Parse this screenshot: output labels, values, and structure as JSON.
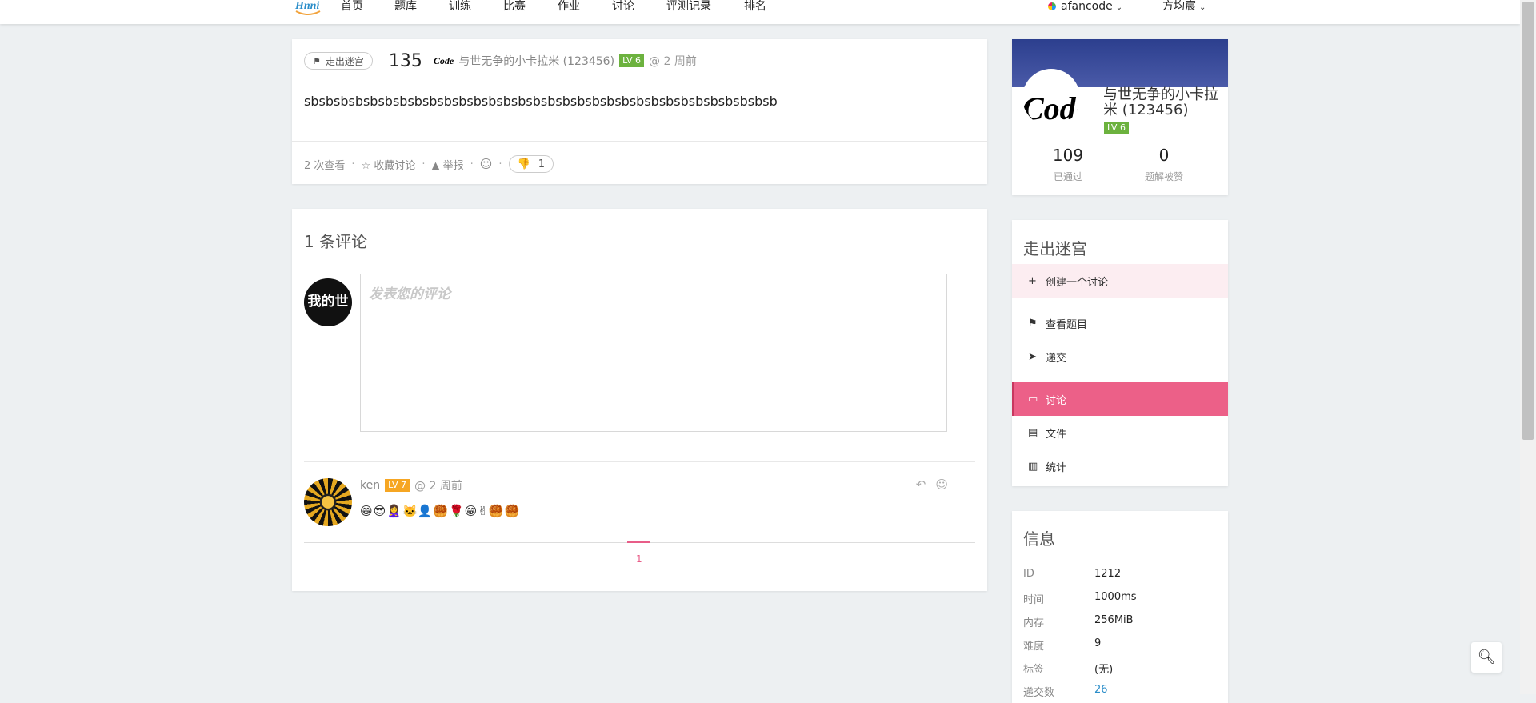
{
  "nav": {
    "logo": "Hnni",
    "items": [
      "首页",
      "题库",
      "训练",
      "比赛",
      "作业",
      "讨论",
      "评测记录",
      "排名"
    ],
    "user": "afancode",
    "account": "方均宸"
  },
  "discussion": {
    "tag": "走出迷宫",
    "title": "135",
    "author_avatar_text": "Code",
    "author": "与世无争的小卡拉米 (123456)",
    "level": "LV 6",
    "time": "@ 2 周前",
    "body": "sbsbsbsbsbsbsbsbsbsbsbsbsbsbsbsbsbsbsbsbsbsbsbsbsbsbsbsbsbsbsbsb",
    "views": "2 次查看",
    "star": "☆ 收藏讨论",
    "report": "▲ 举报",
    "emoji": "☺",
    "thumbs": "1"
  },
  "comments": {
    "title": "1 条评论",
    "my_avatar_text": "我的世界",
    "placeholder": "发表您的评论",
    "list": [
      {
        "user": "ken",
        "level": "LV 7",
        "time": "@ 2 周前",
        "content": "😁😎🙎‍♀️🐱‍👤🥮🌹😁✌🥮🥮"
      }
    ],
    "page": "1"
  },
  "profile": {
    "avatar_text": "Code",
    "name": "与世无争的小卡拉米 (123456)",
    "level": "LV 6",
    "stats": [
      {
        "value": "109",
        "label": "已通过"
      },
      {
        "value": "0",
        "label": "题解被赞"
      }
    ]
  },
  "problem_menu": {
    "title": "走出迷宫",
    "items": [
      {
        "icon": "+",
        "label": "创建一个讨论"
      },
      {
        "icon": "⚑",
        "label": "查看题目"
      },
      {
        "icon": "➤",
        "label": "递交"
      },
      {
        "icon": "▭",
        "label": "讨论"
      },
      {
        "icon": "▤",
        "label": "文件"
      },
      {
        "icon": "▥",
        "label": "统计"
      }
    ]
  },
  "info": {
    "title": "信息",
    "rows": [
      {
        "k": "ID",
        "v": "1212"
      },
      {
        "k": "时间",
        "v": "1000ms"
      },
      {
        "k": "内存",
        "v": "256MiB"
      },
      {
        "k": "难度",
        "v": "9"
      },
      {
        "k": "标签",
        "v": "(无)"
      },
      {
        "k": "递交数",
        "v": "26"
      }
    ]
  },
  "colors": {
    "accent": "#ec6088",
    "level_green": "#6cb23e",
    "level_orange": "#f6a623",
    "banner": "#2c3f8e"
  }
}
